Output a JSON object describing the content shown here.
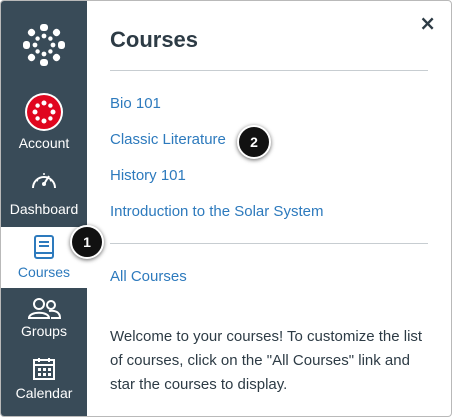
{
  "sidebar": {
    "items": [
      {
        "label": "Account",
        "icon": "avatar-icon"
      },
      {
        "label": "Dashboard",
        "icon": "dashboard-icon"
      },
      {
        "label": "Courses",
        "icon": "courses-icon",
        "active": true
      },
      {
        "label": "Groups",
        "icon": "groups-icon"
      },
      {
        "label": "Calendar",
        "icon": "calendar-icon"
      }
    ]
  },
  "tray": {
    "title": "Courses",
    "close_label": "×",
    "courses": [
      "Bio 101",
      "Classic Literature",
      "History 101",
      "Introduction to the Solar System"
    ],
    "all_courses_label": "All Courses",
    "welcome_text": "Welcome to your courses! To customize the list of courses, click on the \"All Courses\" link and star the courses to display."
  },
  "callouts": [
    "1",
    "2"
  ],
  "colors": {
    "sidebar_bg": "#394b58",
    "link": "#2d7abd",
    "avatar": "#e0061f",
    "text": "#2d3b45"
  }
}
